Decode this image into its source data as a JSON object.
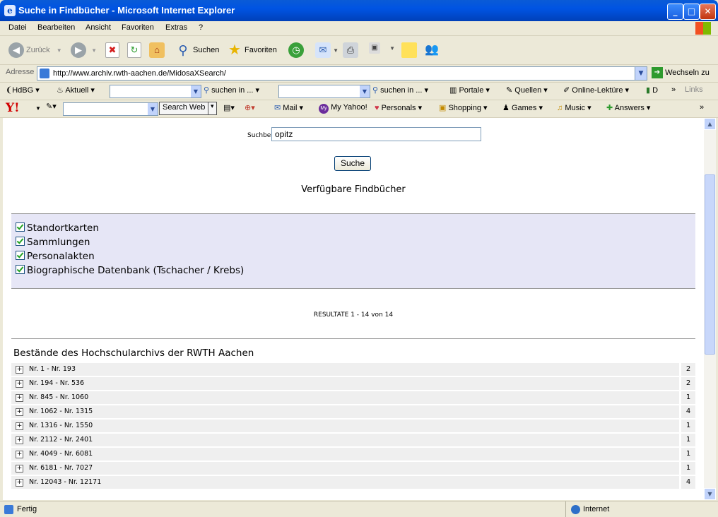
{
  "window": {
    "title": "Suche in Findbücher - Microsoft Internet Explorer"
  },
  "menu": [
    "Datei",
    "Bearbeiten",
    "Ansicht",
    "Favoriten",
    "Extras",
    "?"
  ],
  "toolbar": {
    "back": "Zurück",
    "search": "Suchen",
    "favorites": "Favoriten"
  },
  "address": {
    "label": "Adresse",
    "url": "http://www.archiv.rwth-aachen.de/MidosaXSearch/",
    "go": "Wechseln zu"
  },
  "links_bar": {
    "items": [
      "HdBG",
      "Aktuell",
      "suchen in ...",
      "suchen in ...",
      "Portale",
      "Quellen",
      "Online-Lektüre",
      "D"
    ],
    "links_label": "Links"
  },
  "yahoo_bar": {
    "search_button": "Search Web",
    "items": [
      "Mail",
      "My Yahoo!",
      "Personals",
      "Shopping",
      "Games",
      "Music",
      "Answers"
    ]
  },
  "page": {
    "search_label": "Suchbegriff:",
    "search_value": "opitz",
    "search_button": "Suche",
    "findbuecher_heading": "Verfügbare Findbücher",
    "findbuecher": [
      "Standortkarten",
      "Sammlungen",
      "Personalakten",
      "Biographische Datenbank (Tschacher / Krebs)"
    ],
    "result_count": "RESULTATE 1 - 14 von 14",
    "bestaende_heading": "Bestände des Hochschularchivs der RWTH Aachen",
    "rows": [
      {
        "range": "Nr. 1 - Nr. 193",
        "count": "2"
      },
      {
        "range": "Nr. 194 - Nr. 536",
        "count": "2"
      },
      {
        "range": "Nr. 845 - Nr. 1060",
        "count": "1"
      },
      {
        "range": "Nr. 1062 - Nr. 1315",
        "count": "4"
      },
      {
        "range": "Nr. 1316 - Nr. 1550",
        "count": "1"
      },
      {
        "range": "Nr. 2112 - Nr. 2401",
        "count": "1"
      },
      {
        "range": "Nr. 4049 - Nr. 6081",
        "count": "1"
      },
      {
        "range": "Nr. 6181 - Nr. 7027",
        "count": "1"
      },
      {
        "range": "Nr. 12043 - Nr. 12171",
        "count": "4"
      }
    ]
  },
  "status": {
    "left": "Fertig",
    "zone": "Internet"
  }
}
